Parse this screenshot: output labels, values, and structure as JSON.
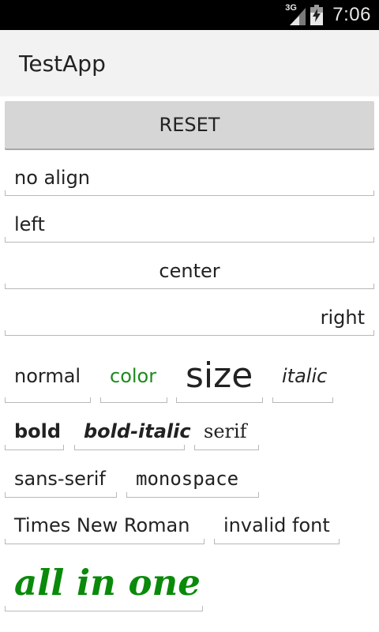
{
  "status_bar": {
    "network_label": "3G",
    "time": "7:06"
  },
  "action_bar": {
    "title": "TestApp"
  },
  "reset_button": {
    "label": "RESET"
  },
  "alignment_fields": [
    {
      "value": "no align",
      "align": "default"
    },
    {
      "value": "left",
      "align": "left"
    },
    {
      "value": "center",
      "align": "center"
    },
    {
      "value": "right",
      "align": "right"
    }
  ],
  "style_fields": {
    "normal": {
      "value": "normal"
    },
    "color": {
      "value": "color",
      "text_color": "#1e8a1e"
    },
    "size": {
      "value": "size"
    },
    "italic": {
      "value": "italic"
    },
    "bold": {
      "value": "bold"
    },
    "bold_italic": {
      "value": "bold-italic"
    },
    "serif": {
      "value": "serif"
    },
    "sans_serif": {
      "value": "sans-serif"
    },
    "monospace": {
      "value": "monospace"
    },
    "times_new_roman": {
      "value": "Times New Roman"
    },
    "invalid_font": {
      "value": "invalid font"
    },
    "all_in_one": {
      "value": "all in one",
      "text_color": "#0a8a0a"
    }
  },
  "colors": {
    "status_bar_bg": "#000000",
    "action_bar_bg": "#f2f2f2",
    "button_bg": "#d6d6d6",
    "underline": "#b8b8b8",
    "accent_green": "#1e8a1e"
  }
}
